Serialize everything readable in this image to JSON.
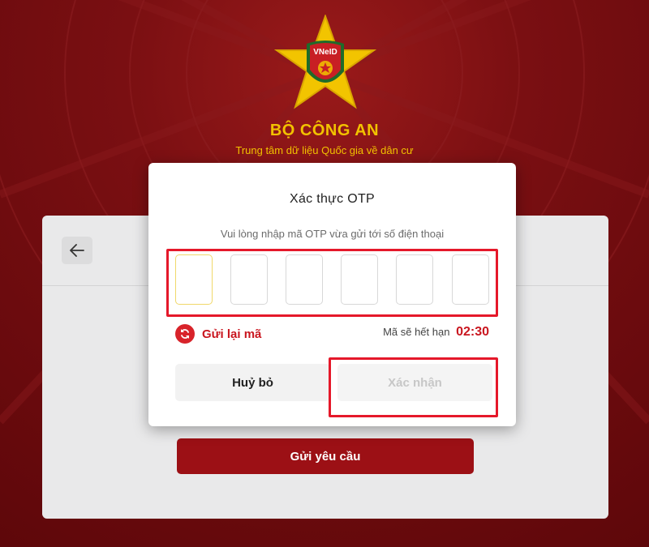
{
  "brand": {
    "logo_text": "VNeID",
    "title": "BỘ CÔNG AN",
    "subtitle": "Trung tâm dữ liệu Quốc gia về dân cư"
  },
  "background_card": {
    "back_icon": "arrow-left-icon",
    "submit_label": "Gửi yêu cầu"
  },
  "modal": {
    "title": "Xác thực OTP",
    "description": "Vui lòng nhập mã OTP vừa gửi tới số điện thoại",
    "otp_values": [
      "",
      "",
      "",
      "",
      "",
      ""
    ],
    "resend_label": "Gửi lại mã",
    "resend_icon": "refresh-icon",
    "expiry_label": "Mã sẽ hết hạn",
    "expiry_time": "02:30",
    "cancel_label": "Huỷ bỏ",
    "confirm_label": "Xác nhận"
  },
  "colors": {
    "background_red": "#7a0f12",
    "brand_gold": "#f2c200",
    "accent_red": "#c9161f",
    "primary_button": "#9c1015",
    "highlight_box": "#e5182a"
  }
}
